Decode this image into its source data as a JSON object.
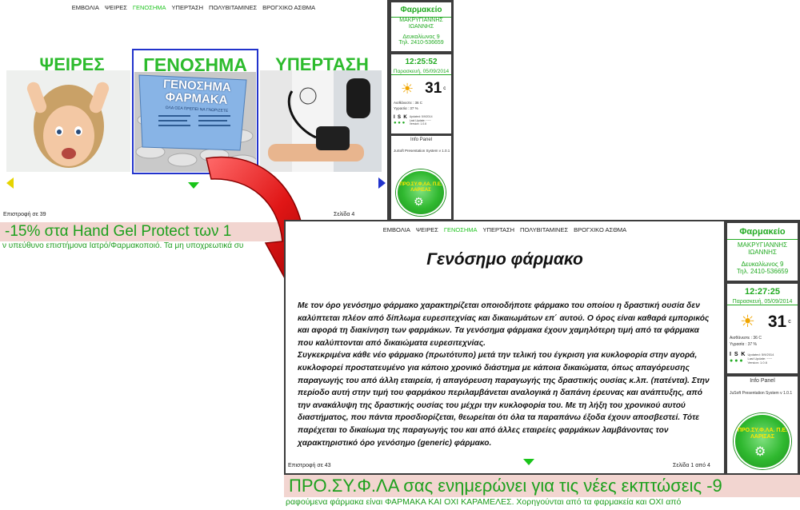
{
  "nav": {
    "items": [
      "ΕΜΒΟΛΙΑ",
      "ΨΕΙΡΕΣ",
      "ΓΕΝΟΣΗΜΑ",
      "ΥΠΕΡΤΑΣΗ",
      "ΠΟΛΥΒΙΤΑΜΙΝΕΣ",
      "ΒΡΟΓΧΙΚΟ ΑΣΘΜΑ"
    ],
    "active": "ΓΕΝΟΣΗΜΑ"
  },
  "screen1": {
    "categories": [
      {
        "title": "ΨΕΙΡΕΣ"
      },
      {
        "title": "ΓΕΝΟΣΗΜΑ",
        "book_title": "ΓΕΝΟΣΗΜΑ ΦΑΡΜΑΚΑ",
        "book_subtitle": "ΟΛΑ ΟΣΑ ΠΡΕΠΕΙ ΝΑ ΓΝΩΡΙΖΕΤΕ"
      },
      {
        "title": "ΥΠΕΡΤΑΣΗ"
      }
    ],
    "return_text": "Επιστροφή σε 39",
    "page_text": "Σελίδα 4",
    "clock": "12:25:52",
    "ticker_big": "-15% στα Hand Gel Protect των 1",
    "ticker_small": "ν υπεύθυνο επιστήμονα Ιατρό/Φαρμακοποιό. Τα μη υποχρεωτικά συ"
  },
  "screen2": {
    "title": "Γενόσημο φάρμακο",
    "paragraphs": [
      "Με τον όρο γενόσημο φάρμακο χαρακτηρίζεται οποιοδήποτε φάρμακο του οποίου η δραστική ουσία δεν καλύπτεται πλέον από δίπλωμα ευρεσιτεχνίας και δικαιωμάτων επ΄ αυτού. Ο όρος είναι καθαρά εμπορικός και αφορά τη διακίνηση των φαρμάκων. Τα γενόσημα φάρμακα έχουν χαμηλότερη τιμή από τα φάρμακα που καλύπτονται από δικαιώματα ευρεσιτεχνίας.",
      "Συγκεκριμένα κάθε νέο φάρμακο (πρωτότυπο) μετά την τελική του έγκριση για κυκλοφορία στην αγορά, κυκλοφορεί προστατευμένο για κάποιο χρονικό διάστημα με κάποια δικαιώματα, όπως απαγόρευσης παραγωγής του από άλλη εταιρεία, ή απαγόρευση παραγωγής της δραστικής ουσίας κ.λπ. (πατέντα). Στην περίοδο αυτή στην τιμή του φαρμάκου περιλαμβάνεται αναλογικά η δαπάνη έρευνας και ανάπτυξης, από την ανακάλυψη της δραστικής ουσίας του μέχρι την κυκλοφορία του. Με τη λήξη του χρονικού αυτού διαστήματος, που πάντα προσδιορίζεται, θεωρείται ότι όλα τα παραπάνω έξοδα έχουν αποσβεστεί. Τότε παρέχεται το δικαίωμα της παραγωγής του και από άλλες εταιρείες φαρμάκων λαμβάνοντας τον χαρακτηριστικό όρο γενόσημο (generic) φάρμακο."
    ],
    "return_text": "Επιστροφή σε 43",
    "page_text": "Σελίδα 1 από 4",
    "clock": "12:27:25",
    "ticker_big": "ΠΡΟ.ΣΥ.Φ.ΛΑ σας ενημερώνει για τις νέες εκπτώσεις -9",
    "ticker_small": "ραφούμενα φάρμακα είναι ΦΑΡΜΑΚΑ ΚΑΙ ΟΧΙ ΚΑΡΑΜΕΛΕΣ. Χορηγούνται από τα φαρμακεία και ΟΧΙ από"
  },
  "sidebar": {
    "title": "Φαρμακείο",
    "owner": "ΜΑΚΡΥΓΙΑΝΝΗΣ ΙΩΑΝΝΗΣ",
    "address": "Δευκαλίωνος 9",
    "phone": "Τηλ.    2410-536659",
    "date": "Παρασκευή, 05/09/2014",
    "temperature": "31",
    "temp_unit": "c",
    "feels_like": "Αισθάνεστε : 36 C",
    "humidity": "Υγρασία : 37 %",
    "isk_letters": [
      "I",
      "S",
      "K"
    ],
    "status_lines": [
      "Updated: 5/9/2014",
      "Last Update: ~~~",
      "Version: 1.0.6"
    ],
    "info_panel_title": "Info Panel",
    "info_panel_text": "JuSoft Presentation System v 1.0.1",
    "logo_text": "ΠΡΟ.ΣΥ.Φ.ΛΑ. Π.Ε. ΛΑΡΙΣΑΣ"
  },
  "colors": {
    "accent_green": "#22aa22",
    "frame": "#3c3c3c",
    "ticker_bg": "#f2d5d0",
    "selection": "#2233cc",
    "arrow_red": "#dd1a1a"
  }
}
